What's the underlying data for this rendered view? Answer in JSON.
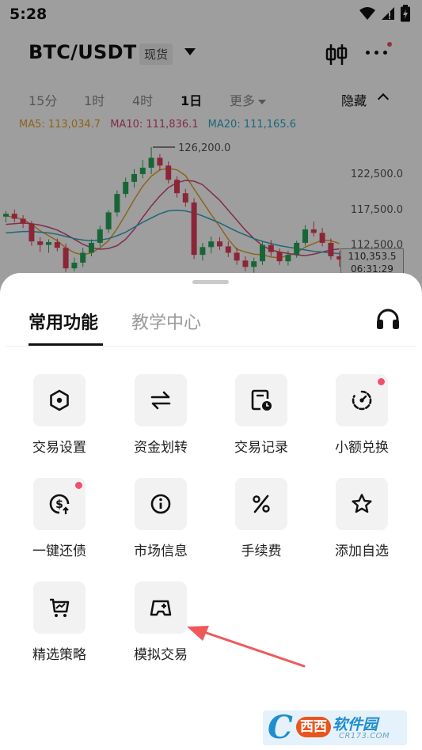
{
  "status_bar": {
    "time": "5:28",
    "icons": [
      "wifi-icon",
      "signal-icon",
      "battery-charging-icon"
    ]
  },
  "header": {
    "pair": "BTC/USDT",
    "market_type": "现货",
    "icons": [
      "candlestick-icon",
      "more-icon"
    ],
    "notification_dot_color": "#f0506e"
  },
  "timeframes": {
    "items": [
      "15分",
      "1时",
      "4时",
      "1日",
      "更多"
    ],
    "active": "1日",
    "hide_label": "隐藏"
  },
  "indicators": {
    "ma5": "MA5: 113,034.7",
    "ma10": "MA10: 111,836.1",
    "ma20": "MA20: 111,165.6",
    "colors": {
      "ma5": "#e3a22a",
      "ma10": "#d2477a",
      "ma20": "#2ea7c6"
    }
  },
  "chart_data": {
    "type": "candlestick",
    "price_labels": [
      "122,500.0",
      "117,500.0",
      "112,500.0"
    ],
    "price_levels": [
      122500,
      117500,
      112500
    ],
    "high_marker": "126,200.0",
    "high_value": 126200,
    "current_price": "110,353.5",
    "countdown": "06:31:29",
    "up_color": "#27a55a",
    "down_color": "#e23c5b",
    "candles": [
      {
        "o": 116400,
        "h": 117200,
        "l": 115600,
        "c": 116800
      },
      {
        "o": 116800,
        "h": 117400,
        "l": 115600,
        "c": 116100
      },
      {
        "o": 116100,
        "h": 116600,
        "l": 114800,
        "c": 115400
      },
      {
        "o": 115400,
        "h": 115800,
        "l": 112300,
        "c": 112900
      },
      {
        "o": 112900,
        "h": 113500,
        "l": 111400,
        "c": 112400
      },
      {
        "o": 112400,
        "h": 113200,
        "l": 111300,
        "c": 112800
      },
      {
        "o": 112800,
        "h": 113300,
        "l": 111500,
        "c": 112000
      },
      {
        "o": 112000,
        "h": 112600,
        "l": 108600,
        "c": 109100
      },
      {
        "o": 109100,
        "h": 110600,
        "l": 108700,
        "c": 109900
      },
      {
        "o": 109900,
        "h": 112000,
        "l": 109300,
        "c": 111300
      },
      {
        "o": 111300,
        "h": 113200,
        "l": 110800,
        "c": 112700
      },
      {
        "o": 112700,
        "h": 115100,
        "l": 112200,
        "c": 114600
      },
      {
        "o": 114600,
        "h": 117300,
        "l": 114100,
        "c": 117000
      },
      {
        "o": 117000,
        "h": 120100,
        "l": 116400,
        "c": 119600
      },
      {
        "o": 119600,
        "h": 121900,
        "l": 119100,
        "c": 121300
      },
      {
        "o": 121300,
        "h": 123100,
        "l": 120500,
        "c": 122400
      },
      {
        "o": 122400,
        "h": 124400,
        "l": 121800,
        "c": 123300
      },
      {
        "o": 123300,
        "h": 126200,
        "l": 122400,
        "c": 124700
      },
      {
        "o": 124700,
        "h": 125200,
        "l": 122900,
        "c": 123600
      },
      {
        "o": 123600,
        "h": 124200,
        "l": 121100,
        "c": 121600
      },
      {
        "o": 121600,
        "h": 122100,
        "l": 119100,
        "c": 119700
      },
      {
        "o": 119700,
        "h": 120300,
        "l": 117800,
        "c": 118400
      },
      {
        "o": 118400,
        "h": 119000,
        "l": 110400,
        "c": 111000
      },
      {
        "o": 111000,
        "h": 112700,
        "l": 110200,
        "c": 112100
      },
      {
        "o": 112100,
        "h": 113600,
        "l": 111200,
        "c": 112900
      },
      {
        "o": 112900,
        "h": 113500,
        "l": 111700,
        "c": 112200
      },
      {
        "o": 112200,
        "h": 112900,
        "l": 110700,
        "c": 111300
      },
      {
        "o": 111300,
        "h": 112000,
        "l": 109600,
        "c": 110200
      },
      {
        "o": 110200,
        "h": 110800,
        "l": 108700,
        "c": 109300
      },
      {
        "o": 109300,
        "h": 110600,
        "l": 108500,
        "c": 110100
      },
      {
        "o": 110100,
        "h": 112800,
        "l": 109600,
        "c": 112400
      },
      {
        "o": 112400,
        "h": 113100,
        "l": 110800,
        "c": 111400
      },
      {
        "o": 111400,
        "h": 111900,
        "l": 109600,
        "c": 110100
      },
      {
        "o": 110100,
        "h": 111600,
        "l": 109500,
        "c": 111000
      },
      {
        "o": 111000,
        "h": 113000,
        "l": 110600,
        "c": 112700
      },
      {
        "o": 112700,
        "h": 115200,
        "l": 112300,
        "c": 114600
      },
      {
        "o": 114600,
        "h": 115700,
        "l": 113600,
        "c": 114100
      },
      {
        "o": 114100,
        "h": 114800,
        "l": 112200,
        "c": 112700
      },
      {
        "o": 112700,
        "h": 113300,
        "l": 110300,
        "c": 110800
      },
      {
        "o": 110800,
        "h": 111500,
        "l": 109300,
        "c": 110353.5
      }
    ],
    "ma_series": [
      {
        "name": "MA5",
        "color": "#e3a22a",
        "values": [
          116500,
          116300,
          116000,
          115300,
          114400,
          113700,
          113000,
          112000,
          111300,
          111000,
          111300,
          112000,
          113000,
          114700,
          116700,
          118800,
          120700,
          122100,
          123000,
          123200,
          123000,
          122200,
          120300,
          118500,
          116700,
          115000,
          113200,
          111800,
          111400,
          111100,
          111000,
          110700,
          110600,
          110900,
          111300,
          112100,
          112600,
          113100,
          113000,
          112600
        ]
      },
      {
        "name": "MA10",
        "color": "#d2477a",
        "values": [
          115300,
          115400,
          115500,
          115400,
          115200,
          114900,
          114500,
          113900,
          113200,
          112500,
          112000,
          111800,
          111900,
          112300,
          113200,
          114600,
          116300,
          117900,
          119300,
          120500,
          121200,
          121500,
          121400,
          120900,
          119800,
          118700,
          117300,
          115900,
          114500,
          113300,
          112300,
          111700,
          111400,
          111200,
          111000,
          110900,
          111100,
          111400,
          111700,
          111836.1
        ]
      },
      {
        "name": "MA20",
        "color": "#2ea7c6",
        "values": [
          114100,
          114200,
          114300,
          114300,
          114200,
          114100,
          113900,
          113600,
          113300,
          113100,
          113000,
          113100,
          113300,
          113700,
          114200,
          114900,
          115600,
          116200,
          116800,
          117200,
          117300,
          117200,
          116900,
          116500,
          116000,
          115500,
          114900,
          114300,
          113800,
          113300,
          112900,
          112600,
          112300,
          112100,
          111900,
          111700,
          111500,
          111400,
          111300,
          111165.6
        ]
      }
    ]
  },
  "sheet": {
    "tabs": [
      {
        "label": "常用功能",
        "active": true
      },
      {
        "label": "教学中心",
        "active": false
      }
    ],
    "support_icon": "headset-icon",
    "items": [
      {
        "label": "交易设置",
        "icon": "hexagon-settings-icon",
        "badge": false
      },
      {
        "label": "资金划转",
        "icon": "transfer-arrows-icon",
        "badge": false
      },
      {
        "label": "交易记录",
        "icon": "record-clock-icon",
        "badge": false
      },
      {
        "label": "小额兑换",
        "icon": "dial-convert-icon",
        "badge": true
      },
      {
        "label": "一键还债",
        "icon": "dollar-repay-icon",
        "badge": true
      },
      {
        "label": "市场信息",
        "icon": "info-icon",
        "badge": false
      },
      {
        "label": "手续费",
        "icon": "percent-icon",
        "badge": false
      },
      {
        "label": "添加自选",
        "icon": "star-icon",
        "badge": false
      },
      {
        "label": "精选策略",
        "icon": "strategy-cart-icon",
        "badge": false
      },
      {
        "label": "模拟交易",
        "icon": "gamepad-icon",
        "badge": false
      }
    ],
    "annotation_arrow_color": "#ee5a5a"
  },
  "watermark": {
    "badge": "西西",
    "title": "软件园",
    "sub": "CR173.COM"
  }
}
